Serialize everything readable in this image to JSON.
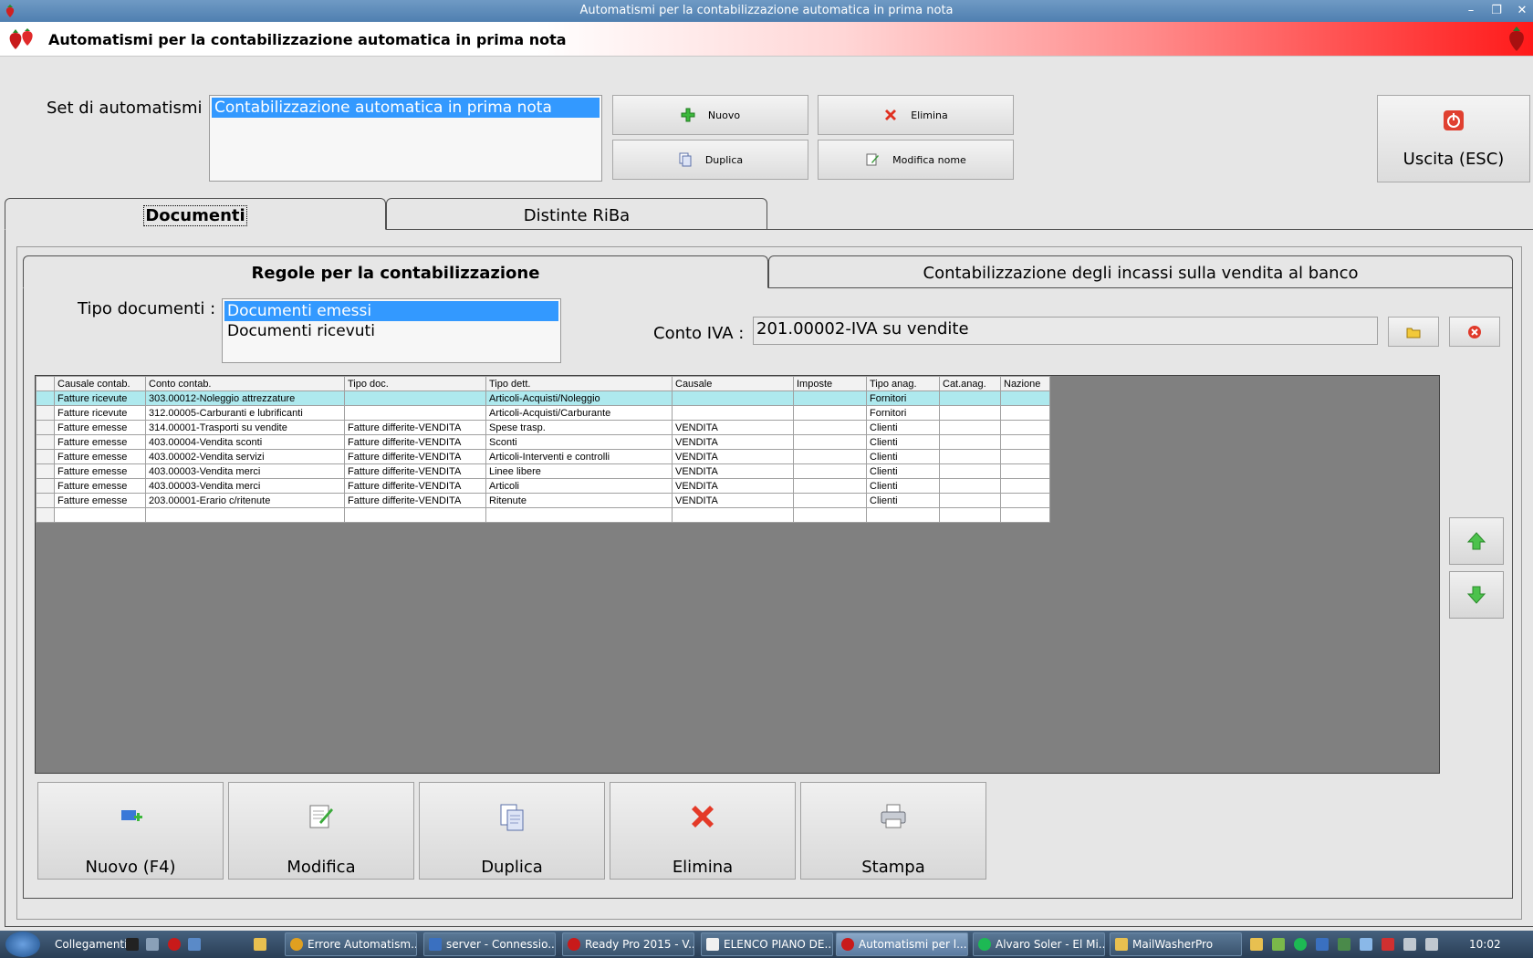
{
  "window": {
    "title": "Automatismi per la contabilizzazione automatica in prima nota"
  },
  "header": {
    "title": "Automatismi per la contabilizzazione automatica in prima nota"
  },
  "set": {
    "label": "Set di automatismi :",
    "items": [
      "Contabilizzazione automatica in prima nota"
    ]
  },
  "set_buttons": {
    "nuovo": "Nuovo",
    "elimina": "Elimina",
    "duplica": "Duplica",
    "modifica_nome": "Modifica nome"
  },
  "exit_button": "Uscita (ESC)",
  "tabs": [
    "Documenti",
    "Distinte RiBa"
  ],
  "subtabs": [
    "Regole per la contabilizzazione",
    "Contabilizzazione degli incassi sulla vendita al banco"
  ],
  "tipo_documenti": {
    "label": "Tipo documenti :",
    "items": [
      "Documenti emessi",
      "Documenti ricevuti"
    ]
  },
  "conto_iva": {
    "label": "Conto IVA :",
    "value": "201.00002-IVA su vendite"
  },
  "grid": {
    "columns": [
      "Causale contab.",
      "Conto contab.",
      "Tipo doc.",
      "Tipo dett.",
      "Causale",
      "Imposte",
      "Tipo anag.",
      "Cat.anag.",
      "Nazione"
    ],
    "rows": [
      [
        "Fatture ricevute",
        "303.00012-Noleggio attrezzature",
        "",
        "Articoli-Acquisti/Noleggio",
        "",
        "",
        "Fornitori",
        "",
        ""
      ],
      [
        "Fatture ricevute",
        "312.00005-Carburanti e lubrificanti",
        "",
        "Articoli-Acquisti/Carburante",
        "",
        "",
        "Fornitori",
        "",
        ""
      ],
      [
        "Fatture emesse",
        "314.00001-Trasporti su vendite",
        "Fatture differite-VENDITA",
        "Spese trasp.",
        "VENDITA",
        "",
        "Clienti",
        "",
        ""
      ],
      [
        "Fatture emesse",
        "403.00004-Vendita sconti",
        "Fatture differite-VENDITA",
        "Sconti",
        "VENDITA",
        "",
        "Clienti",
        "",
        ""
      ],
      [
        "Fatture emesse",
        "403.00002-Vendita servizi",
        "Fatture differite-VENDITA",
        "Articoli-Interventi e controlli",
        "VENDITA",
        "",
        "Clienti",
        "",
        ""
      ],
      [
        "Fatture emesse",
        "403.00003-Vendita merci",
        "Fatture differite-VENDITA",
        "Linee libere",
        "VENDITA",
        "",
        "Clienti",
        "",
        ""
      ],
      [
        "Fatture emesse",
        "403.00003-Vendita merci",
        "Fatture differite-VENDITA",
        "Articoli",
        "VENDITA",
        "",
        "Clienti",
        "",
        ""
      ],
      [
        "Fatture emesse",
        "203.00001-Erario c/ritenute",
        "Fatture differite-VENDITA",
        "Ritenute",
        "VENDITA",
        "",
        "Clienti",
        "",
        ""
      ],
      [
        "",
        "",
        "",
        "",
        "",
        "",
        "",
        "",
        ""
      ]
    ]
  },
  "bottom_buttons": [
    "Nuovo (F4)",
    "Modifica",
    "Duplica",
    "Elimina",
    "Stampa"
  ],
  "taskbar": {
    "links_label": "Collegamenti",
    "buttons": [
      "Errore Automatism...",
      "server - Connessio...",
      "Ready Pro 2015 - V...",
      "ELENCO PIANO DE...",
      "Automatismi per l...",
      "Alvaro Soler - El Mi...",
      "MailWasherPro"
    ],
    "clock": "10:02"
  },
  "colors": {
    "accent_selection": "#3399ff",
    "row_highlight": "#aee9ee",
    "header_gradient_end": "#ff1a1a"
  }
}
